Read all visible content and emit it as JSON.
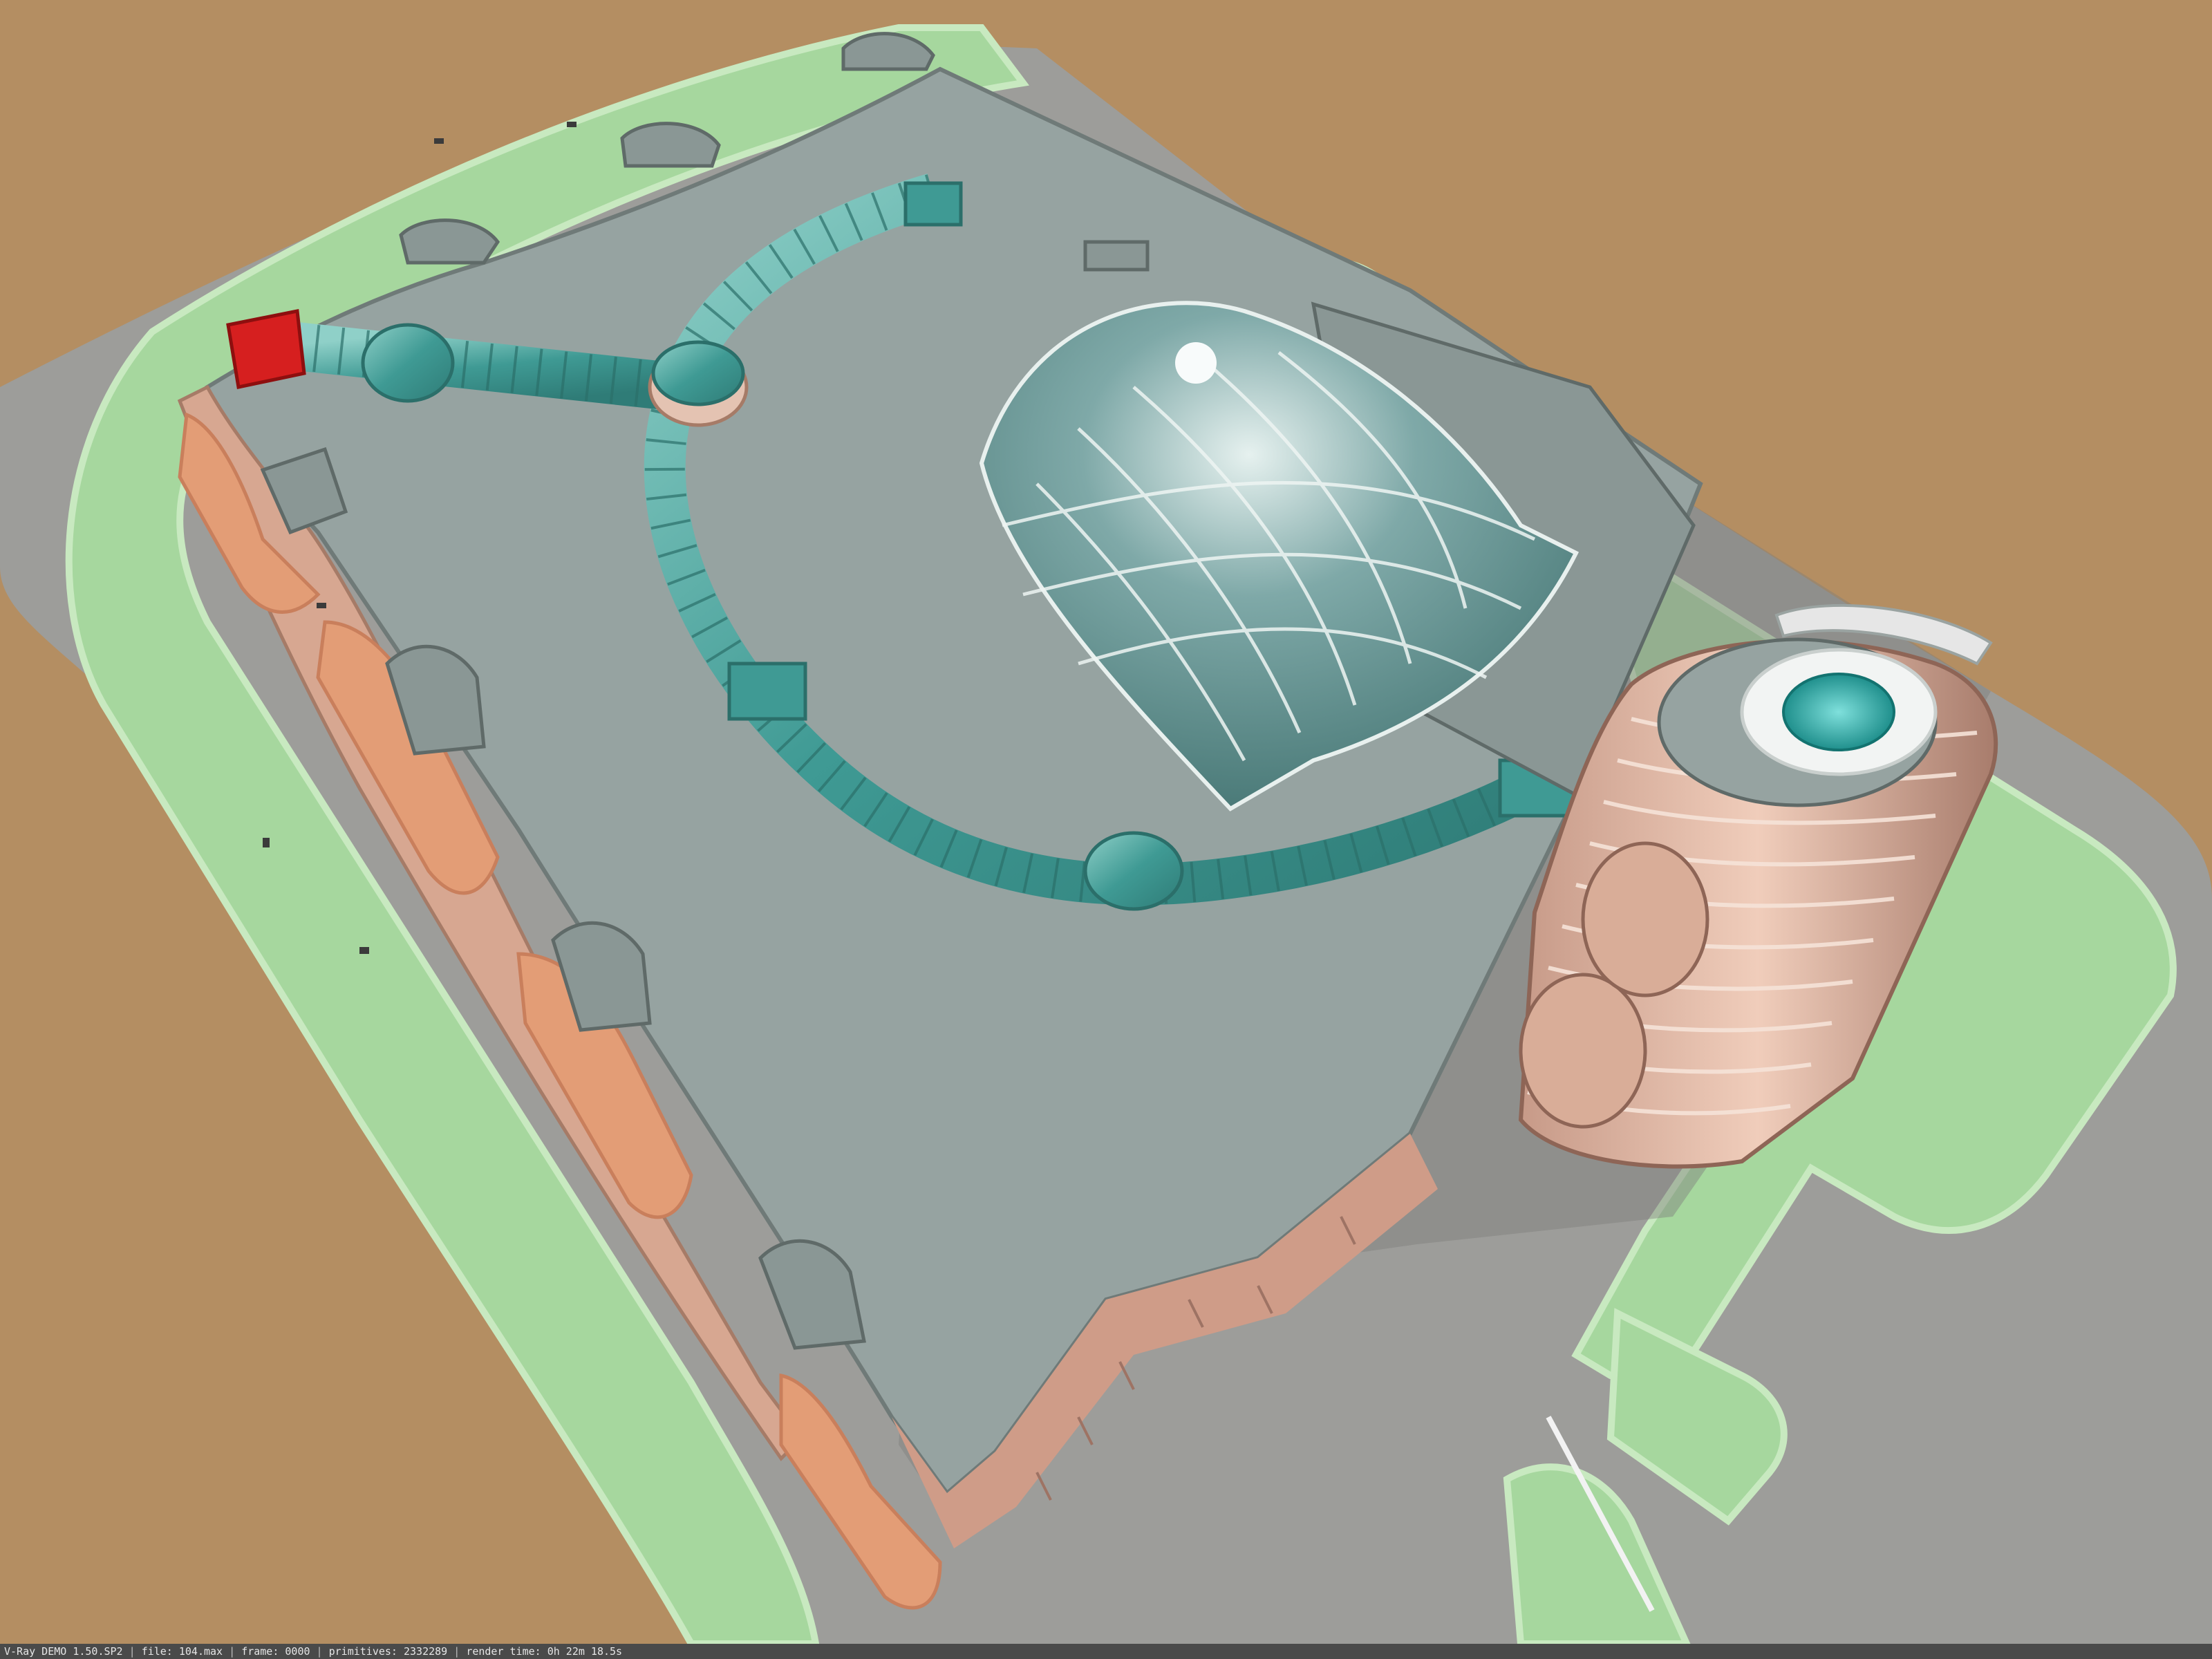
{
  "render_info": {
    "renderer": "V-Ray DEMO 1.50.SP2",
    "file": "file: 104.max",
    "frame": "frame: 0000",
    "primitives": "primitives: 2332289",
    "render_time": "render time: 0h 22m 18.5s"
  },
  "colors": {
    "ground": "#b48e62",
    "road": "#9d9d9a",
    "lawn": "#a6d79e",
    "lawn_edge": "#c8e9c0",
    "roof": "#96a3a1",
    "roof_dark": "#7f8c8a",
    "plaza": "#e39d76",
    "facade": "#d7a791",
    "glass": "#3f9a94",
    "glass_light": "#7cc3bd",
    "accent_red": "#d61f1f",
    "status_bar": "#4a4a4a"
  }
}
